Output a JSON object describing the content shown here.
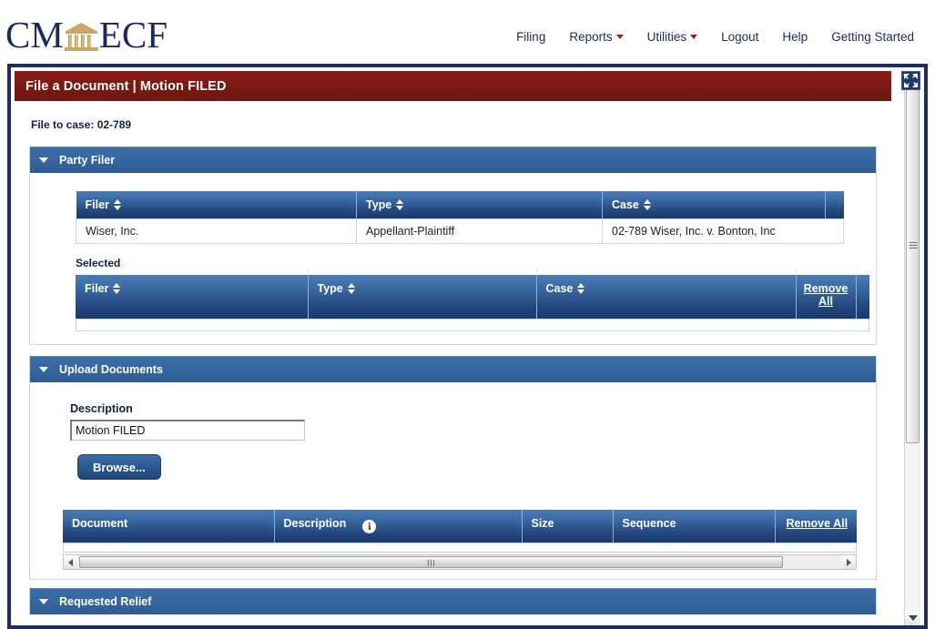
{
  "branding": {
    "logo_cm": "CM",
    "logo_ecf": "ECF",
    "logo_icon": "courthouse-icon",
    "logo_color": "#1b2a5e",
    "logo_accent_color": "#c8a96a"
  },
  "nav": {
    "items": [
      {
        "label": "Filing",
        "has_dropdown": false
      },
      {
        "label": "Reports",
        "has_dropdown": true
      },
      {
        "label": "Utilities",
        "has_dropdown": true
      },
      {
        "label": "Logout",
        "has_dropdown": false
      },
      {
        "label": "Help",
        "has_dropdown": false
      },
      {
        "label": "Getting Started",
        "has_dropdown": false
      }
    ],
    "caret_color": "#99202a"
  },
  "window": {
    "title": "File a Document | Motion FILED",
    "title_bar_color": "#7d1a13",
    "expand_icon": "expand-arrows-icon"
  },
  "case": {
    "label": "File to case:",
    "number": "02-789",
    "full": "File to case: 02-789"
  },
  "sections": {
    "party_filer": {
      "title": "Party Filer",
      "caret": "triangle-down-icon",
      "available_table": {
        "columns": [
          {
            "label": "Filer",
            "sort_icon": "sort-updown-icon"
          },
          {
            "label": "Type",
            "sort_icon": "sort-updown-icon"
          },
          {
            "label": "Case",
            "sort_icon": "sort-updown-icon"
          }
        ],
        "rows": [
          {
            "filer": "Wiser, Inc.",
            "type": "Appellant-Plaintiff",
            "case": "02-789 Wiser, Inc. v. Bonton, Inc"
          }
        ]
      },
      "selected_label": "Selected",
      "selected_table": {
        "columns": [
          {
            "label": "Filer",
            "sort_icon": "sort-updown-icon"
          },
          {
            "label": "Type",
            "sort_icon": "sort-updown-icon"
          },
          {
            "label": "Case",
            "sort_icon": "sort-updown-icon"
          },
          {
            "label": "Remove All",
            "is_link": true
          }
        ],
        "rows": []
      }
    },
    "upload_documents": {
      "title": "Upload Documents",
      "caret": "triangle-down-icon",
      "description_label": "Description",
      "description_value": "Motion FILED",
      "description_placeholder": "",
      "browse_label": "Browse...",
      "documents_table": {
        "columns": [
          {
            "label": "Document"
          },
          {
            "label": "Description",
            "info_icon": "info-circle-icon"
          },
          {
            "label": "Size"
          },
          {
            "label": "Sequence"
          },
          {
            "label": "Remove All",
            "is_link": true
          }
        ],
        "rows": []
      }
    },
    "requested_relief": {
      "title": "Requested Relief",
      "caret": "triangle-down-icon"
    }
  },
  "scrollbars": {
    "vertical": {
      "up_icon": "triangle-up-icon",
      "down_icon": "triangle-down-icon"
    },
    "horizontal": {
      "left_icon": "triangle-left-icon",
      "right_icon": "triangle-right-icon"
    }
  }
}
